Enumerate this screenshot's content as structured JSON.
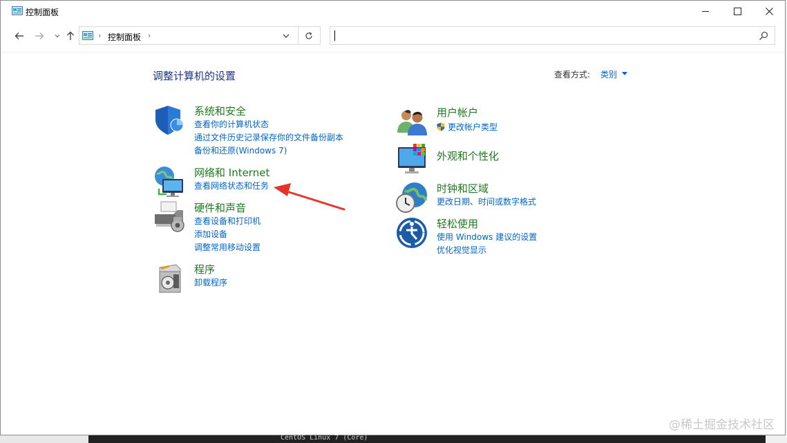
{
  "window": {
    "title": "控制面板",
    "controls": {
      "minimize": "minimize-icon",
      "maximize": "maximize-icon",
      "close": "close-icon"
    }
  },
  "nav": {
    "address_crumb": "控制面板",
    "separator": "›",
    "search_placeholder": ""
  },
  "content": {
    "heading": "调整计算机的设置",
    "view_by_label": "查看方式:",
    "view_by_value": "类别",
    "categories_left": [
      {
        "title": "系统和安全",
        "icon": "shield-icon",
        "links": [
          "查看你的计算机状态",
          "通过文件历史记录保存你的文件备份副本",
          "备份和还原(Windows 7)"
        ]
      },
      {
        "title": "网络和 Internet",
        "icon": "network-icon",
        "links": [
          "查看网络状态和任务"
        ]
      },
      {
        "title": "硬件和声音",
        "icon": "printer-icon",
        "links": [
          "查看设备和打印机",
          "添加设备",
          "调整常用移动设置"
        ]
      },
      {
        "title": "程序",
        "icon": "programs-icon",
        "links": [
          "卸载程序"
        ]
      }
    ],
    "categories_right": [
      {
        "title": "用户帐户",
        "icon": "users-icon",
        "links": [
          "更改帐户类型"
        ]
      },
      {
        "title": "外观和个性化",
        "icon": "appearance-icon",
        "links": []
      },
      {
        "title": "时钟和区域",
        "icon": "clock-globe-icon",
        "links": [
          "更改日期、时间或数字格式"
        ]
      },
      {
        "title": "轻松使用",
        "icon": "ease-of-access-icon",
        "links": [
          "使用 Windows 建议的设置",
          "优化视觉显示"
        ]
      }
    ]
  },
  "annotation": {
    "color": "#e8322a"
  },
  "watermark": "@稀土掘金技术社区",
  "background_console": "CentOS Linux 7 (Core)",
  "colors": {
    "link": "#0066cc",
    "category_title": "#1e7a1e",
    "heading": "#1e3287"
  }
}
